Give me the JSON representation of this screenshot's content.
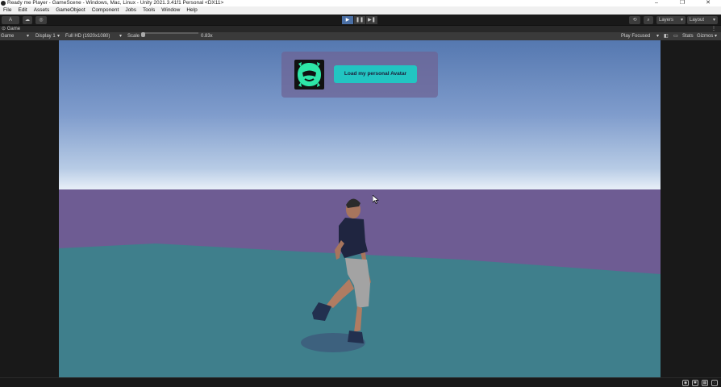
{
  "window": {
    "title": "Ready me Player - GameScene - Windows, Mac, Linux - Unity 2021.3.41f1 Personal <DX11>",
    "controls": [
      "–",
      "❐",
      "✕"
    ]
  },
  "menu": [
    "File",
    "Edit",
    "Assets",
    "GameObject",
    "Component",
    "Jobs",
    "Tools",
    "Window",
    "Help"
  ],
  "toolbar": {
    "account_label": "A",
    "play_icons": [
      "▶",
      "❚❚",
      "▶❚"
    ],
    "layers_label": "Layers",
    "layout_label": "Layout"
  },
  "game_tab": {
    "label": "Game"
  },
  "game_bar": {
    "view_label": "Game",
    "display_label": "Display 1",
    "resolution_label": "Full HD (1920x1080)",
    "scale_label": "Scale",
    "scale_value": "0.83x",
    "play_mode_label": "Play Focused",
    "stats_label": "Stats",
    "gizmos_label": "Gizmos"
  },
  "avatar_panel": {
    "button_label": "Load my personal Avatar"
  },
  "colors": {
    "button_accent": "#22c5c2",
    "logo_accent": "#2ee6a8",
    "play_active": "#4a6fa5"
  }
}
